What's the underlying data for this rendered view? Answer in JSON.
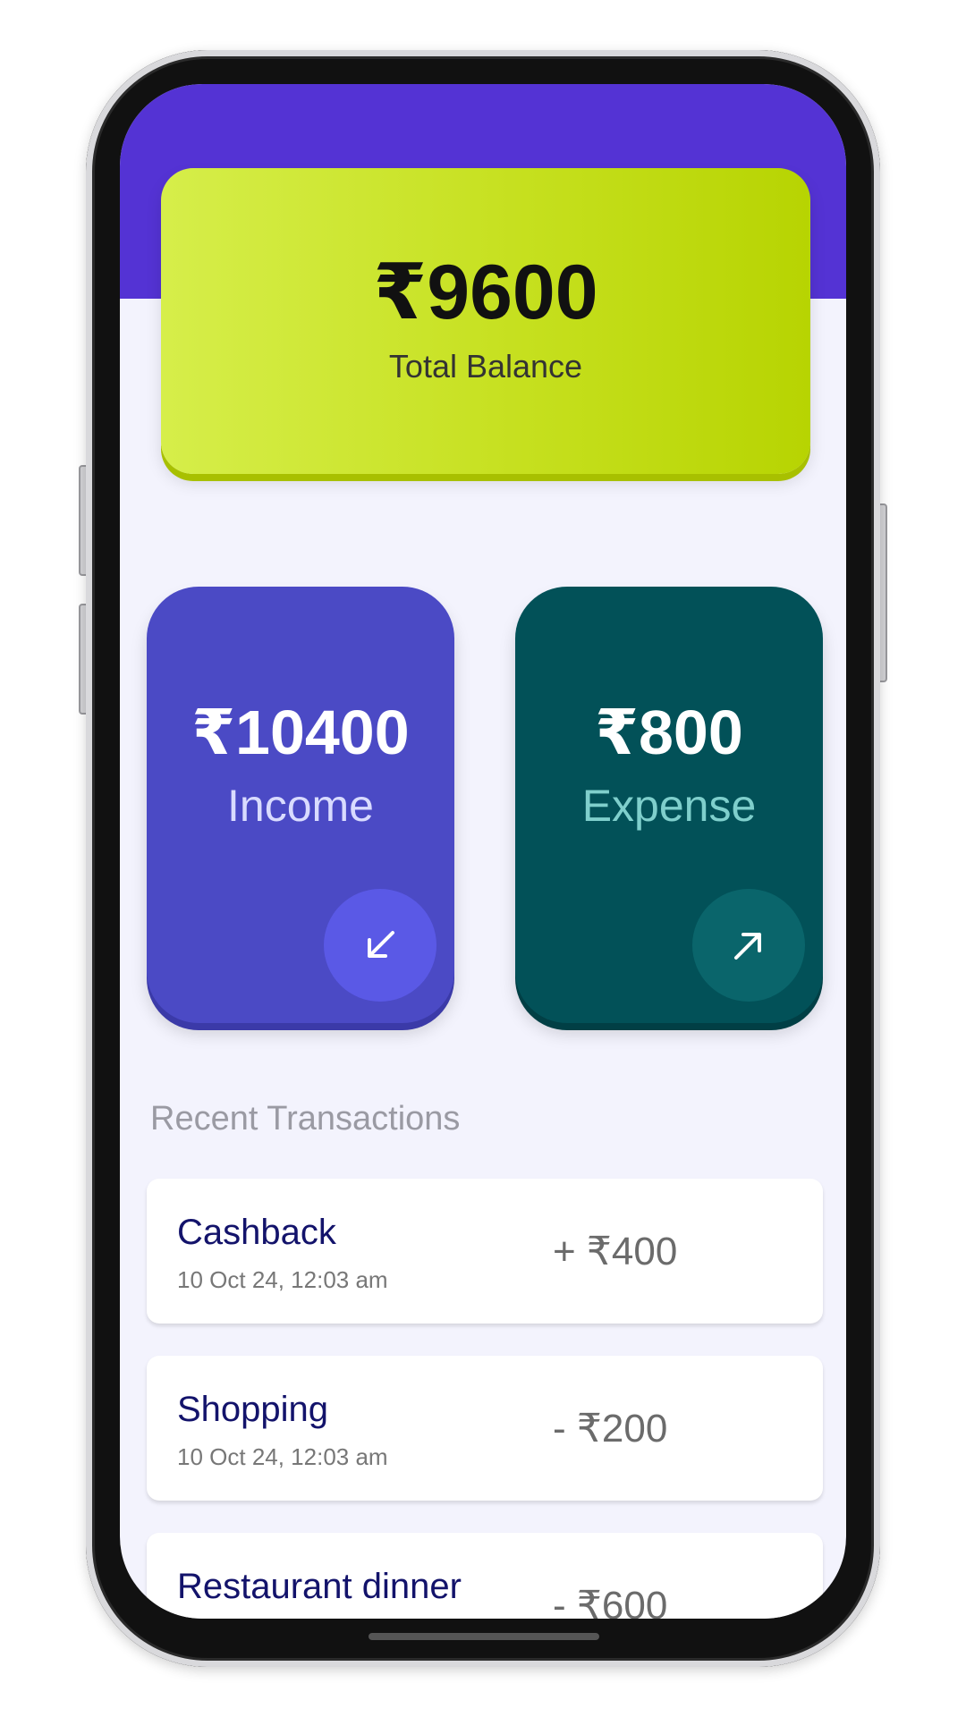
{
  "balance": {
    "amount": "₹9600",
    "label": "Total Balance"
  },
  "income": {
    "amount": "₹10400",
    "label": "Income",
    "icon": "arrow-down-left-icon"
  },
  "expense": {
    "amount": "₹800",
    "label": "Expense",
    "icon": "arrow-up-right-icon"
  },
  "recent": {
    "title": "Recent Transactions"
  },
  "transactions": [
    {
      "name": "Cashback",
      "date": "10 Oct 24, 12:03 am",
      "amount": "+ ₹400"
    },
    {
      "name": "Shopping",
      "date": "10 Oct 24, 12:03 am",
      "amount": "- ₹200"
    },
    {
      "name": "Restaurant dinner",
      "date": "",
      "amount": "- ₹600"
    }
  ],
  "colors": {
    "header": "#5433d4",
    "balance_card": "#c6e01f",
    "income_card": "#4b4ac5",
    "expense_card": "#025158",
    "background": "#f3f3fd"
  }
}
